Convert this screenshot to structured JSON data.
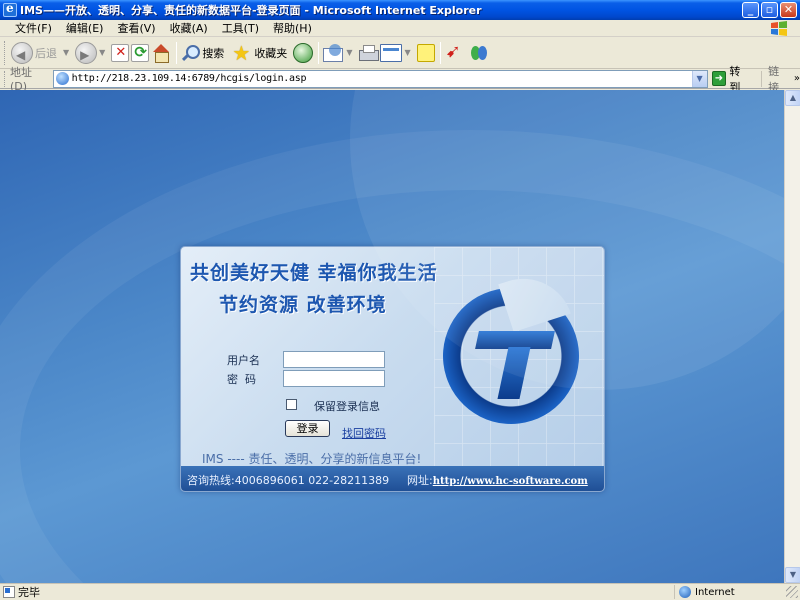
{
  "window": {
    "title": "IMS——开放、透明、分享、责任的新数据平台-登录页面 - Microsoft Internet Explorer"
  },
  "menubar": {
    "items": [
      "文件(F)",
      "编辑(E)",
      "查看(V)",
      "收藏(A)",
      "工具(T)",
      "帮助(H)"
    ]
  },
  "toolbar": {
    "back_label": "后退",
    "search_label": "搜索",
    "favorites_label": "收藏夹"
  },
  "addressbar": {
    "label": "地址(D)",
    "url": "http://218.23.109.14:6789/hcgis/login.asp",
    "go_label": "转到",
    "links_label": "链接"
  },
  "login": {
    "slogan_line1": "共创美好天健 幸福你我生活",
    "slogan_line2": "节约资源 改善环境",
    "username_label": "用户名",
    "password_label": "密  码",
    "username_value": "",
    "password_value": "",
    "remember_label": "保留登录信息",
    "remember_checked": false,
    "login_button": "登录",
    "forgot_link": "找回密码",
    "tagline": "IMS ---- 责任、透明、分享的新信息平台!",
    "hotline": "咨询热线:4006896061  022-28211389",
    "site_label": "网址:",
    "site_url": "http://www.hc-software.com"
  },
  "statusbar": {
    "status_text": "完毕",
    "zone_label": "Internet"
  }
}
